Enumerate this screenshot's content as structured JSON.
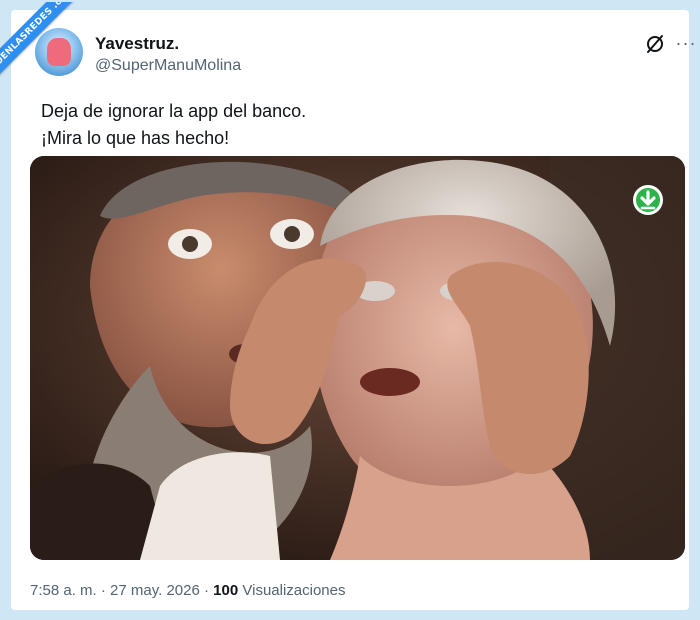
{
  "watermark": {
    "text": "VISTOENLASREDES .com"
  },
  "author": {
    "display_name": "Yavestruz.",
    "handle": "@SuperManuMolina"
  },
  "header_icons": {
    "grok": "grok-icon",
    "more": "more-options-icon",
    "more_glyph": "···"
  },
  "tweet": {
    "lines": [
      "Deja de ignorar la app del banco.",
      "¡Mira lo que has hecho!"
    ]
  },
  "media": {
    "download_icon": "download-icon"
  },
  "meta": {
    "time": "7:58 a. m.",
    "separator": "·",
    "date": "27 may. 2026",
    "views_count": "100",
    "views_label": "Visualizaciones"
  },
  "colors": {
    "background": "#cfe6f5",
    "card": "#ffffff",
    "text_primary": "#0f1419",
    "text_secondary": "#536471",
    "ribbon": "#2f8ff0",
    "download_green": "#2bb34a"
  }
}
